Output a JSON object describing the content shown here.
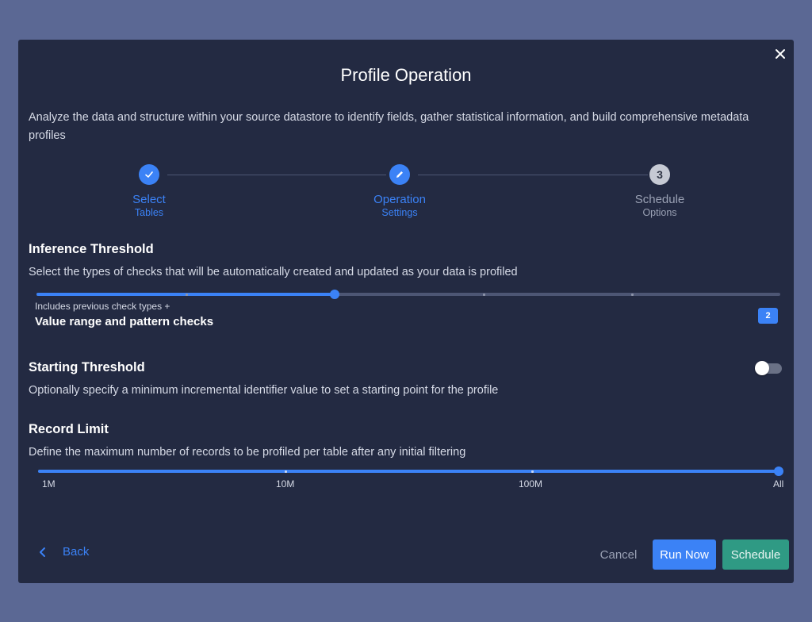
{
  "dialog": {
    "title": "Profile Operation",
    "description": "Analyze the data and structure within your source datastore to identify fields, gather statistical information, and build comprehensive metadata profiles",
    "close_icon": "close-icon"
  },
  "stepper": {
    "steps": [
      {
        "line1": "Select",
        "line2": "Tables",
        "state": "done",
        "icon": "check-icon"
      },
      {
        "line1": "Operation",
        "line2": "Settings",
        "state": "active",
        "icon": "pencil-icon"
      },
      {
        "line1": "Schedule",
        "line2": "Options",
        "state": "pending",
        "number": "3"
      }
    ]
  },
  "inference": {
    "title": "Inference Threshold",
    "description": "Select the types of checks that will be automatically created and updated as your data is profiled",
    "note": "Includes previous check types +",
    "level_name": "Value range and pattern checks",
    "level": "2",
    "max_level": 5
  },
  "starting_threshold": {
    "title": "Starting Threshold",
    "description": "Optionally specify a minimum incremental identifier value to set a starting point for the profile",
    "enabled": false
  },
  "record_limit": {
    "title": "Record Limit",
    "description": "Define the maximum number of records to be profiled per table after any initial filtering",
    "marks": [
      "1M",
      "10M",
      "100M",
      "All"
    ],
    "selected": "All"
  },
  "footer": {
    "back_label": "Back",
    "cancel_label": "Cancel",
    "run_now_label": "Run Now",
    "schedule_label": "Schedule"
  },
  "colors": {
    "accent": "#3b82f6",
    "schedule": "#2f9a84",
    "background": "#232a42",
    "backdrop": "#5b6894"
  }
}
